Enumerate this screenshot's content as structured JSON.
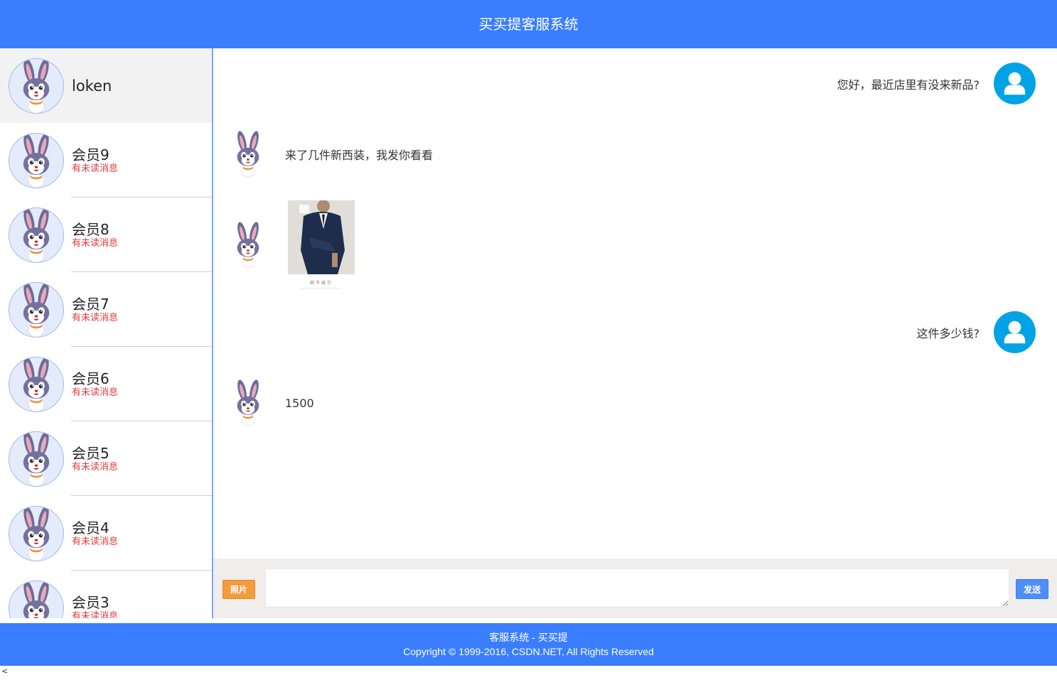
{
  "header": {
    "title": "买买提客服系统"
  },
  "sidebar": {
    "contacts": [
      {
        "name": "loken",
        "status": "",
        "active": true,
        "avatar": "bunny-avatar"
      },
      {
        "name": "会员9",
        "status": "有未读消息",
        "active": false,
        "avatar": "bunny-avatar"
      },
      {
        "name": "会员8",
        "status": "有未读消息",
        "active": false,
        "avatar": "bunny-avatar"
      },
      {
        "name": "会员7",
        "status": "有未读消息",
        "active": false,
        "avatar": "bunny-avatar"
      },
      {
        "name": "会员6",
        "status": "有未读消息",
        "active": false,
        "avatar": "bunny-avatar"
      },
      {
        "name": "会员5",
        "status": "有未读消息",
        "active": false,
        "avatar": "bunny-avatar"
      },
      {
        "name": "会员4",
        "status": "有未读消息",
        "active": false,
        "avatar": "bunny-avatar"
      },
      {
        "name": "会员3",
        "status": "有未读消息",
        "active": false,
        "avatar": "bunny-avatar"
      }
    ]
  },
  "chat": {
    "messages": [
      {
        "side": "right",
        "type": "text",
        "text": "您好，最近店里有没来新品?",
        "avatar": "user-icon"
      },
      {
        "side": "left",
        "type": "text",
        "text": "来了几件新西装，我发你看看",
        "avatar": "bunny-avatar"
      },
      {
        "side": "left",
        "type": "image",
        "caption": "细节展示",
        "avatar": "bunny-avatar"
      },
      {
        "side": "right",
        "type": "text",
        "text": "这件多少钱?",
        "avatar": "user-icon"
      },
      {
        "side": "left",
        "type": "text",
        "text": "1500",
        "avatar": "bunny-avatar"
      }
    ]
  },
  "input_bar": {
    "photo_label": "照片",
    "input_value": "",
    "send_label": "发送"
  },
  "footer": {
    "line1": "客服系统 - 买买提",
    "line2": "Copyright © 1999-2016, CSDN.NET, All Rights Reserved"
  },
  "misc": {
    "bottom_char": "<"
  },
  "colors": {
    "brand": "#3a7eff",
    "unread": "#e0393e",
    "photo_button": "#f49c3c",
    "send_button": "#4d8ff8",
    "user_avatar": "#00a3e6"
  }
}
